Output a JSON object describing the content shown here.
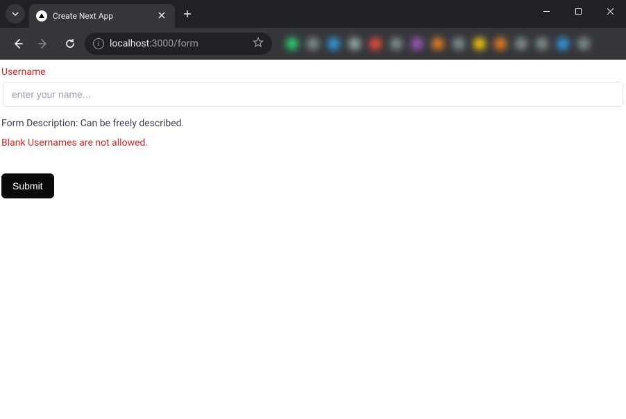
{
  "window": {
    "tab_title": "Create Next App"
  },
  "address_bar": {
    "host": "localhost:",
    "port_path": "3000/form"
  },
  "form": {
    "label": "Username",
    "placeholder": "enter your name...",
    "description": "Form Description: Can be freely described.",
    "error": "Blank Usernames are not allowed.",
    "submit_label": "Submit"
  }
}
